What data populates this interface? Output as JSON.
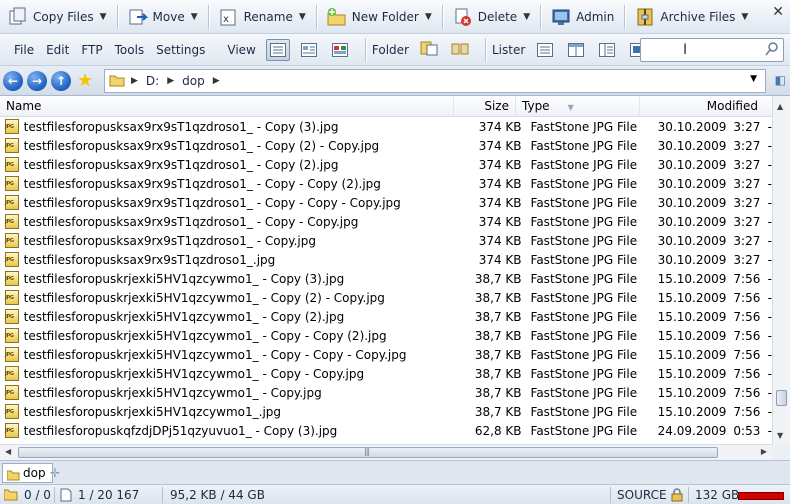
{
  "toolbar": {
    "copy_files": "Copy Files",
    "move": "Move",
    "rename": "Rename",
    "new_folder": "New Folder",
    "delete": "Delete",
    "admin": "Admin",
    "archive_files": "Archive Files"
  },
  "menu": {
    "file": "File",
    "edit": "Edit",
    "ftp": "FTP",
    "tools": "Tools",
    "settings": "Settings",
    "view": "View",
    "folder": "Folder",
    "lister": "Lister"
  },
  "search": {
    "value": "",
    "placeholder": ""
  },
  "address": {
    "drive": "D:",
    "folder": "dop"
  },
  "columns": {
    "name": "Name",
    "size": "Size",
    "type": "Type",
    "modified": "Modified"
  },
  "files": [
    {
      "name": "testfilesforopusksax9rx9sT1qzdroso1_ - Copy (3).jpg",
      "size": "374 KB",
      "type": "FastStone JPG File",
      "date": "30.10.2009",
      "time": "3:27",
      "extra": "-"
    },
    {
      "name": "testfilesforopusksax9rx9sT1qzdroso1_ - Copy (2) - Copy.jpg",
      "size": "374 KB",
      "type": "FastStone JPG File",
      "date": "30.10.2009",
      "time": "3:27",
      "extra": "-"
    },
    {
      "name": "testfilesforopusksax9rx9sT1qzdroso1_ - Copy (2).jpg",
      "size": "374 KB",
      "type": "FastStone JPG File",
      "date": "30.10.2009",
      "time": "3:27",
      "extra": "-"
    },
    {
      "name": "testfilesforopusksax9rx9sT1qzdroso1_ - Copy - Copy (2).jpg",
      "size": "374 KB",
      "type": "FastStone JPG File",
      "date": "30.10.2009",
      "time": "3:27",
      "extra": "-"
    },
    {
      "name": "testfilesforopusksax9rx9sT1qzdroso1_ - Copy - Copy - Copy.jpg",
      "size": "374 KB",
      "type": "FastStone JPG File",
      "date": "30.10.2009",
      "time": "3:27",
      "extra": "-"
    },
    {
      "name": "testfilesforopusksax9rx9sT1qzdroso1_ - Copy - Copy.jpg",
      "size": "374 KB",
      "type": "FastStone JPG File",
      "date": "30.10.2009",
      "time": "3:27",
      "extra": "-"
    },
    {
      "name": "testfilesforopusksax9rx9sT1qzdroso1_ - Copy.jpg",
      "size": "374 KB",
      "type": "FastStone JPG File",
      "date": "30.10.2009",
      "time": "3:27",
      "extra": "-"
    },
    {
      "name": "testfilesforopusksax9rx9sT1qzdroso1_.jpg",
      "size": "374 KB",
      "type": "FastStone JPG File",
      "date": "30.10.2009",
      "time": "3:27",
      "extra": "-"
    },
    {
      "name": "testfilesforopuskrjexki5HV1qzcywmo1_ - Copy (3).jpg",
      "size": "38,7 KB",
      "type": "FastStone JPG File",
      "date": "15.10.2009",
      "time": "7:56",
      "extra": "-"
    },
    {
      "name": "testfilesforopuskrjexki5HV1qzcywmo1_ - Copy (2) - Copy.jpg",
      "size": "38,7 KB",
      "type": "FastStone JPG File",
      "date": "15.10.2009",
      "time": "7:56",
      "extra": "-"
    },
    {
      "name": "testfilesforopuskrjexki5HV1qzcywmo1_ - Copy (2).jpg",
      "size": "38,7 KB",
      "type": "FastStone JPG File",
      "date": "15.10.2009",
      "time": "7:56",
      "extra": "-"
    },
    {
      "name": "testfilesforopuskrjexki5HV1qzcywmo1_ - Copy - Copy (2).jpg",
      "size": "38,7 KB",
      "type": "FastStone JPG File",
      "date": "15.10.2009",
      "time": "7:56",
      "extra": "-"
    },
    {
      "name": "testfilesforopuskrjexki5HV1qzcywmo1_ - Copy - Copy - Copy.jpg",
      "size": "38,7 KB",
      "type": "FastStone JPG File",
      "date": "15.10.2009",
      "time": "7:56",
      "extra": "-"
    },
    {
      "name": "testfilesforopuskrjexki5HV1qzcywmo1_ - Copy - Copy.jpg",
      "size": "38,7 KB",
      "type": "FastStone JPG File",
      "date": "15.10.2009",
      "time": "7:56",
      "extra": "-"
    },
    {
      "name": "testfilesforopuskrjexki5HV1qzcywmo1_ - Copy.jpg",
      "size": "38,7 KB",
      "type": "FastStone JPG File",
      "date": "15.10.2009",
      "time": "7:56",
      "extra": "-"
    },
    {
      "name": "testfilesforopuskrjexki5HV1qzcywmo1_.jpg",
      "size": "38,7 KB",
      "type": "FastStone JPG File",
      "date": "15.10.2009",
      "time": "7:56",
      "extra": "-"
    },
    {
      "name": "testfilesforopuskqfzdjDPj51qzyuvuo1_ - Copy (3).jpg",
      "size": "62,8 KB",
      "type": "FastStone JPG File",
      "date": "24.09.2009",
      "time": "0:53",
      "extra": "-"
    }
  ],
  "tab": {
    "label": "dop"
  },
  "status": {
    "selected_dirs": "0 / 0",
    "selected_files": "1 / 20 167",
    "size_info": "95,2 KB / 44 GB",
    "source": "SOURCE",
    "free_space": "132 GB"
  },
  "colors": {
    "accent_blue": "#1d5fbf",
    "disk_bar": "#d40000",
    "toolbar_bg": "#dfe7f1"
  },
  "icons": [
    "copy-files-icon",
    "move-icon",
    "rename-icon",
    "new-folder-icon",
    "delete-icon",
    "admin-icon",
    "archive-icon",
    "back-icon",
    "forward-icon",
    "up-icon",
    "favorites-icon",
    "folder-icon",
    "search-icon",
    "jpg-file-icon",
    "lock-icon"
  ]
}
